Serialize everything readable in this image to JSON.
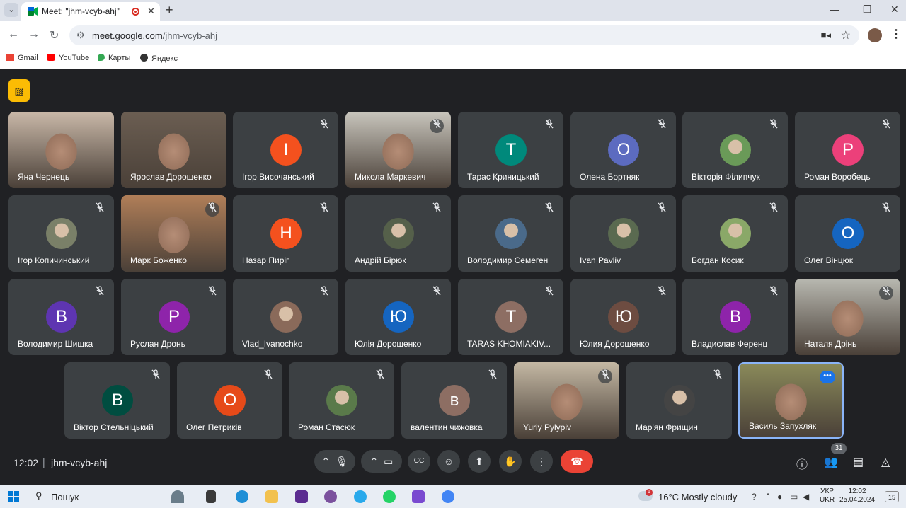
{
  "browser": {
    "tab_title": "Meet: \"jhm-vcyb-ahj\"",
    "url_host": "meet.google.com",
    "url_path": "/jhm-vcyb-ahj",
    "bookmarks": [
      {
        "label": "Gmail",
        "icon": "gmail-icon",
        "color": "#ea4335"
      },
      {
        "label": "YouTube",
        "icon": "youtube-icon",
        "color": "#ff0000"
      },
      {
        "label": "Карты",
        "icon": "maps-icon",
        "color": "#34a853"
      },
      {
        "label": "Яндекс",
        "icon": "yandex-icon",
        "color": "#333333"
      }
    ]
  },
  "meet": {
    "participants": [
      {
        "name": "Яна Чернець",
        "type": "video",
        "muted": false,
        "bg": "#c9b8a8"
      },
      {
        "name": "Ярослав Дорошенко",
        "type": "video",
        "muted": false,
        "bg": "#6b5e52"
      },
      {
        "name": "Ігор Височанський",
        "type": "letter",
        "letter": "I",
        "color": "#f4511e",
        "muted": true
      },
      {
        "name": "Микола Маркевич",
        "type": "video",
        "muted": true,
        "bg": "#c8c5bc"
      },
      {
        "name": "Тарас Криницький",
        "type": "letter",
        "letter": "T",
        "color": "#00897b",
        "muted": true
      },
      {
        "name": "Олена Бортняк",
        "type": "letter",
        "letter": "O",
        "color": "#5c6bc0",
        "muted": true
      },
      {
        "name": "Вікторія Філипчук",
        "type": "photo",
        "color": "#6a9a58",
        "muted": true
      },
      {
        "name": "Роман Воробець",
        "type": "letter",
        "letter": "P",
        "color": "#ec407a",
        "muted": true
      },
      {
        "name": "Ігор Копичинський",
        "type": "photo",
        "color": "#7a8068",
        "muted": true
      },
      {
        "name": "Марк Боженко",
        "type": "video",
        "muted": true,
        "bg": "#b07e58"
      },
      {
        "name": "Назар Пиріг",
        "type": "letter",
        "letter": "H",
        "color": "#f4511e",
        "muted": true
      },
      {
        "name": "Андрій Бірюк",
        "type": "photo",
        "color": "#55604a",
        "muted": true
      },
      {
        "name": "Володимир Семеген",
        "type": "photo",
        "color": "#4a6a8a",
        "muted": true
      },
      {
        "name": "Ivan Pavliv",
        "type": "photo",
        "color": "#5a6a50",
        "muted": true
      },
      {
        "name": "Богдан Косик",
        "type": "photo",
        "color": "#8aa868",
        "muted": true
      },
      {
        "name": "Олег Вінцюк",
        "type": "letter",
        "letter": "O",
        "color": "#1565c0",
        "muted": true
      },
      {
        "name": "Володимир Шишка",
        "type": "letter",
        "letter": "B",
        "color": "#5e35b1",
        "muted": true
      },
      {
        "name": "Руслан Дронь",
        "type": "letter",
        "letter": "P",
        "color": "#8e24aa",
        "muted": true
      },
      {
        "name": "Vlad_Ivanochko",
        "type": "photo",
        "color": "#8a6a5a",
        "muted": true
      },
      {
        "name": "Юлія Дорошенко",
        "type": "letter",
        "letter": "Ю",
        "color": "#1565c0",
        "muted": true
      },
      {
        "name": "TARAS KHOMIAKIV...",
        "type": "letter",
        "letter": "T",
        "color": "#8d6e63",
        "muted": true
      },
      {
        "name": "Юлия Дорошенко",
        "type": "letter",
        "letter": "Ю",
        "color": "#6d4c41",
        "muted": true
      },
      {
        "name": "Владислав Ференц",
        "type": "letter",
        "letter": "B",
        "color": "#8e24aa",
        "muted": true
      },
      {
        "name": "Наталя Дрінь",
        "type": "video",
        "muted": true,
        "bg": "#b8b8b0"
      },
      {
        "name": "Віктор Стельніцький",
        "type": "letter",
        "letter": "B",
        "color": "#004d40",
        "muted": true
      },
      {
        "name": "Олег Петриків",
        "type": "letter",
        "letter": "O",
        "color": "#e64a19",
        "muted": true
      },
      {
        "name": "Роман Стасюк",
        "type": "photo",
        "color": "#5a7a4a",
        "muted": true
      },
      {
        "name": "валентин чижовка",
        "type": "letter",
        "letter": "в",
        "color": "#8d6e63",
        "muted": true
      },
      {
        "name": "Yuriy Pylypiv",
        "type": "video",
        "muted": true,
        "bg": "#c4b8a4"
      },
      {
        "name": "Мар'ян Фрищин",
        "type": "photo",
        "color": "#444444",
        "muted": true
      },
      {
        "name": "Василь Запухляк",
        "type": "video",
        "muted": false,
        "active": true,
        "bg": "#8a8a5a"
      }
    ],
    "clock": "12:02",
    "meeting_code": "jhm-vcyb-ahj",
    "participant_count": "31"
  },
  "taskbar": {
    "search_label": "Пошук",
    "weather": "16°C  Mostly cloudy",
    "weather_badge": "1",
    "lang_1": "УКР",
    "lang_2": "UKR",
    "time": "12:02",
    "date": "25.04.2024",
    "notifications": "15"
  }
}
